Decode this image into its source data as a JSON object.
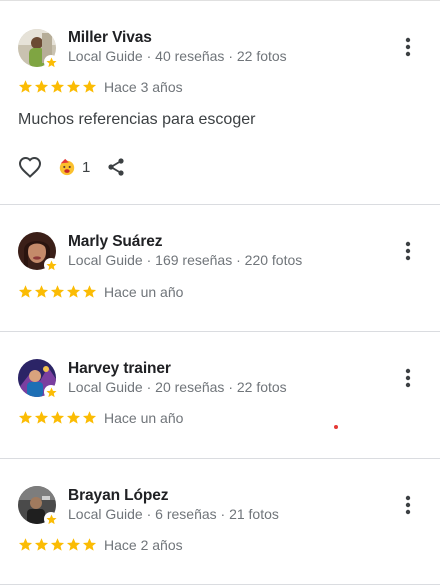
{
  "colors": {
    "star": "#fbbc04",
    "name": "#202124",
    "meta": "#70757a",
    "divider": "#dadce0",
    "badge": "#fbbc04"
  },
  "reviews": [
    {
      "name": "Miller Vivas",
      "meta": "Local Guide · 40 reseñas · 22 fotos",
      "rating": 5,
      "when": "Hace 3 años",
      "text": "Muchos referencias para escoger",
      "reaction_count": "1",
      "avatar_icon": "user-avatar-photo",
      "reaction_icon": "party-emoji-icon"
    },
    {
      "name": "Marly Suárez",
      "meta": "Local Guide · 169 reseñas · 220 fotos",
      "rating": 5,
      "when": "Hace un año",
      "avatar_icon": "user-avatar-photo"
    },
    {
      "name": "Harvey trainer",
      "meta": "Local Guide · 20 reseñas · 22 fotos",
      "rating": 5,
      "when": "Hace un año",
      "avatar_icon": "user-avatar-photo"
    },
    {
      "name": "Brayan López",
      "meta": "Local Guide · 6 reseñas · 21 fotos",
      "rating": 5,
      "when": "Hace 2 años",
      "avatar_icon": "user-avatar-photo"
    }
  ]
}
